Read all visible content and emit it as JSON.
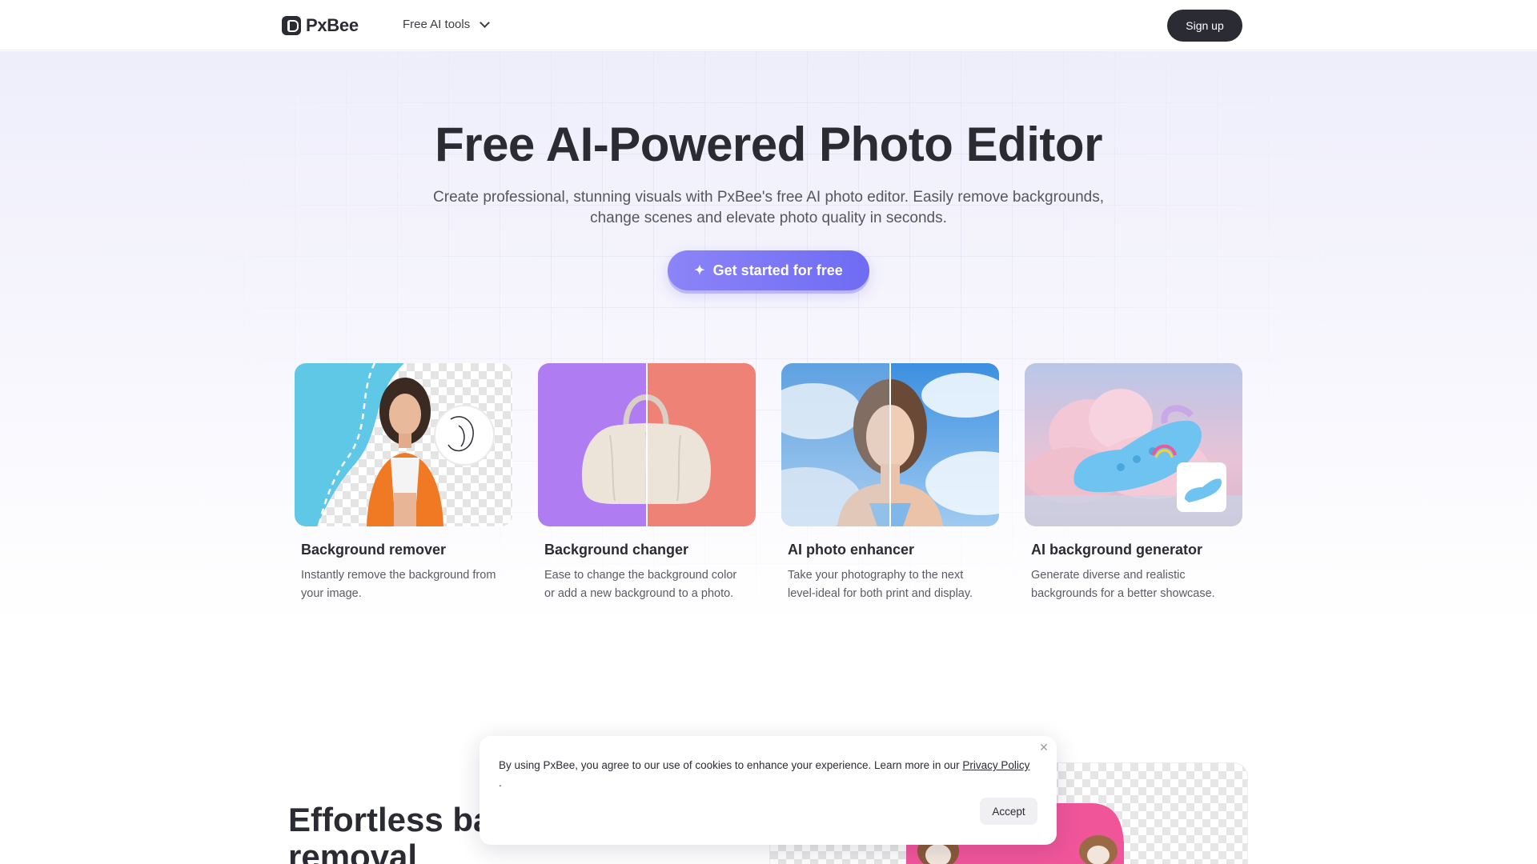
{
  "header": {
    "brand": "PxBee",
    "nav_tools_label": "Free AI tools",
    "signup_label": "Sign up"
  },
  "hero": {
    "title": "Free AI-Powered Photo Editor",
    "subtitle": "Create professional, stunning visuals with PxBee's free AI photo editor. Easily remove backgrounds, change scenes and elevate photo quality in seconds.",
    "cta_label": "Get started for free",
    "cta_icon": "sparkle-icon"
  },
  "cards": [
    {
      "title": "Background remover",
      "desc": "Instantly remove the background from your image."
    },
    {
      "title": "Background changer",
      "desc": "Ease to change the background color or add a new background to a photo."
    },
    {
      "title": "AI photo enhancer",
      "desc": "Take your photography to the next level-ideal for both print and display."
    },
    {
      "title": "AI background generator",
      "desc": "Generate diverse and realistic backgrounds for a better showcase."
    }
  ],
  "section2": {
    "title_visible": "Effortless bac",
    "title_line2": "removal"
  },
  "cookie": {
    "text": "By using PxBee, you agree to our use of cookies to enhance your experience. Learn more in our",
    "link": "Privacy Policy",
    "period": ".",
    "accept_label": "Accept"
  },
  "colors": {
    "brand_dark": "#2b2b33",
    "cta_start": "#8c84f7",
    "cta_end": "#6f6cf4",
    "card1_bg": "#5ec8e6",
    "card2_left": "#b07cf2",
    "card2_right": "#ef8277"
  }
}
